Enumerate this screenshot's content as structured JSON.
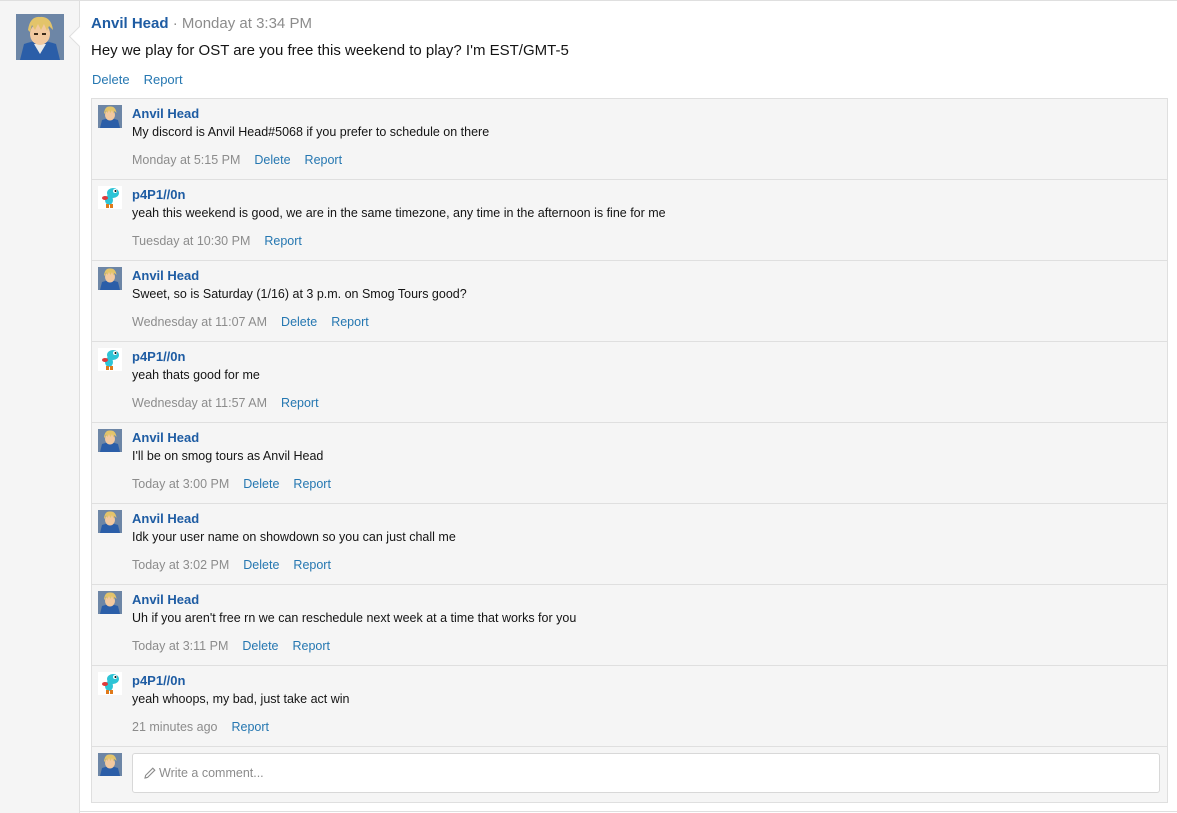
{
  "post": {
    "author": "Anvil Head",
    "separator": " · ",
    "time": "Monday at 3:34 PM",
    "text": "Hey we play for OST are you free this weekend to play? I'm EST/GMT-5",
    "actions": [
      "Delete",
      "Report"
    ]
  },
  "comments": [
    {
      "author": "Anvil Head",
      "avatar": "trainer-avatar",
      "text": "My discord is Anvil Head#5068 if you prefer to schedule on there",
      "time": "Monday at 5:15 PM",
      "actions": [
        "Delete",
        "Report"
      ]
    },
    {
      "author": "p4P1//0n",
      "avatar": "yoshi-avatar",
      "text": "yeah this weekend is good, we are in the same timezone, any time in the afternoon is fine for me",
      "time": "Tuesday at 10:30 PM",
      "actions": [
        "Report"
      ]
    },
    {
      "author": "Anvil Head",
      "avatar": "trainer-avatar",
      "text": "Sweet, so is Saturday (1/16) at 3 p.m. on Smog Tours good?",
      "time": "Wednesday at 11:07 AM",
      "actions": [
        "Delete",
        "Report"
      ]
    },
    {
      "author": "p4P1//0n",
      "avatar": "yoshi-avatar",
      "text": "yeah thats good for me",
      "time": "Wednesday at 11:57 AM",
      "actions": [
        "Report"
      ]
    },
    {
      "author": "Anvil Head",
      "avatar": "trainer-avatar",
      "text": "I'll be on smog tours as Anvil Head",
      "time": "Today at 3:00 PM",
      "actions": [
        "Delete",
        "Report"
      ]
    },
    {
      "author": "Anvil Head",
      "avatar": "trainer-avatar",
      "text": "Idk your user name on showdown so you can just chall me",
      "time": "Today at 3:02 PM",
      "actions": [
        "Delete",
        "Report"
      ]
    },
    {
      "author": "Anvil Head",
      "avatar": "trainer-avatar",
      "text": "Uh if you aren't free rn we can reschedule next week at a time that works for you",
      "time": "Today at 3:11 PM",
      "actions": [
        "Delete",
        "Report"
      ]
    },
    {
      "author": "p4P1//0n",
      "avatar": "yoshi-avatar",
      "text": "yeah whoops, my bad, just take act win",
      "time": "21 minutes ago",
      "actions": [
        "Report"
      ]
    }
  ],
  "composer": {
    "placeholder": "Write a comment...",
    "icon": "pencil-icon"
  },
  "colors": {
    "link": "#2577b1",
    "username": "#1e5ca3",
    "muted": "#8c8c8c",
    "panel": "#f5f5f5",
    "border": "#dfdfdf"
  }
}
